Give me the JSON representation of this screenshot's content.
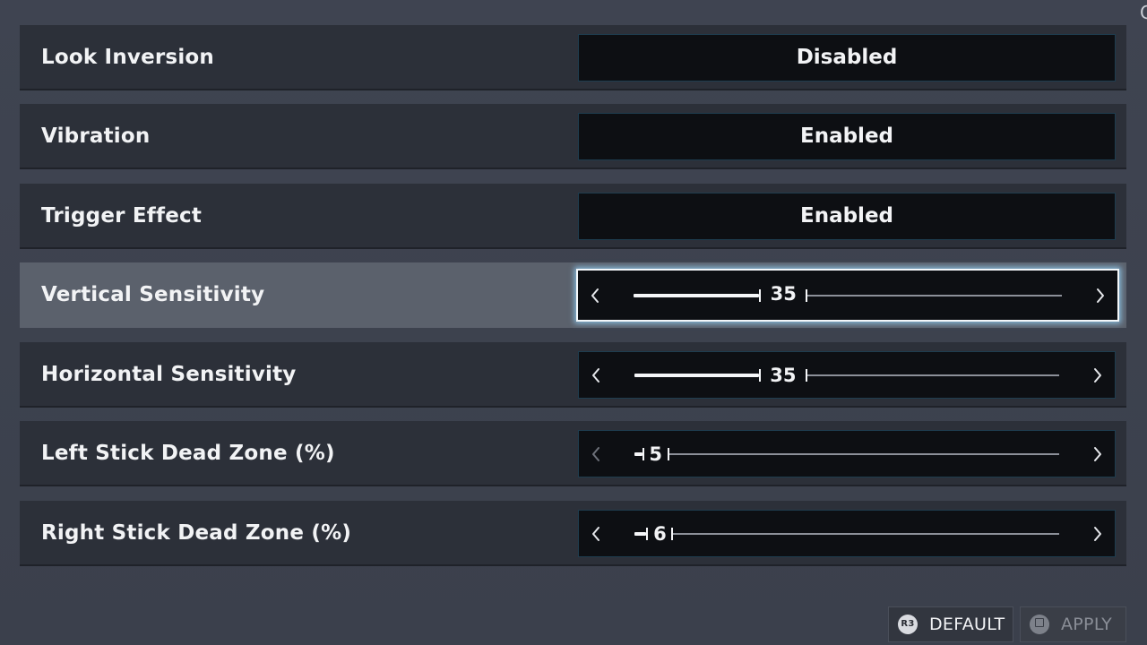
{
  "settings": {
    "look_inversion": {
      "label": "Look Inversion",
      "value": "Disabled"
    },
    "vibration": {
      "label": "Vibration",
      "value": "Enabled"
    },
    "trigger_effect": {
      "label": "Trigger Effect",
      "value": "Enabled"
    },
    "vertical_sensitivity": {
      "label": "Vertical Sensitivity",
      "value": "35",
      "level": 0.35
    },
    "horizontal_sensitivity": {
      "label": "Horizontal Sensitivity",
      "value": "35",
      "level": 0.35
    },
    "left_dead_zone": {
      "label": "Left Stick Dead Zone (%)",
      "value": "5",
      "level": 0.05
    },
    "right_dead_zone": {
      "label": "Right Stick Dead Zone (%)",
      "value": "6",
      "level": 0.06
    }
  },
  "focused_setting": "vertical_sensitivity",
  "footer": {
    "default": {
      "icon": "r3-button-icon",
      "icon_text": "R3",
      "label": "DEFAULT"
    },
    "apply": {
      "icon": "square-button-icon",
      "label": "APPLY",
      "disabled": true
    }
  },
  "colors": {
    "background": "#3f4451",
    "row": "#2c3039",
    "row_focused": "#5b616c",
    "control": "#0d0f13",
    "focus_glow": "#96d7ff",
    "text": "#f2f3f5"
  },
  "icons": {
    "arrow_left": "chevron-left-icon",
    "arrow_right": "chevron-right-icon",
    "corner": "partial-glyph-icon"
  }
}
